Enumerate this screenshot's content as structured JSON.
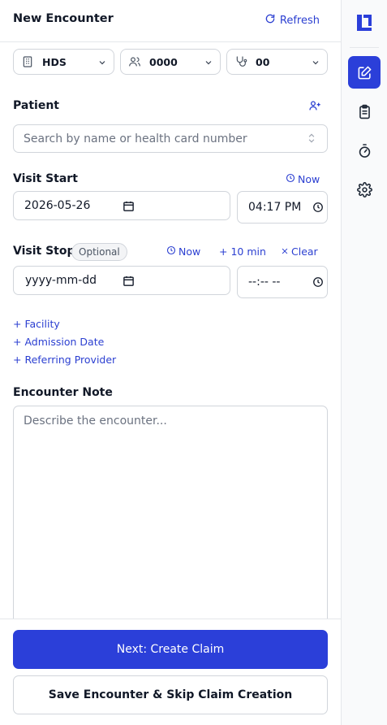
{
  "header": {
    "title": "New Encounter",
    "refresh_label": "Refresh"
  },
  "selectors": {
    "facility": {
      "value": "HDS",
      "icon": "building-icon"
    },
    "practitioner": {
      "value": "0000",
      "icon": "users-icon"
    },
    "specialty": {
      "value": "00",
      "icon": "stethoscope-icon"
    }
  },
  "patient": {
    "label": "Patient",
    "search_placeholder": "Search by name or health card number"
  },
  "visit_start": {
    "label": "Visit Start",
    "now_label": "Now",
    "date": "2026-05-26",
    "time": "04:17 PM"
  },
  "visit_stop": {
    "label": "Visit Stop",
    "optional_badge": "Optional",
    "now_label": "Now",
    "plus_label": "+ 10 min",
    "clear_label": "Clear",
    "date_placeholder": "yyyy-mm-dd",
    "time_placeholder": "--:-- --"
  },
  "extras": {
    "facility": "+ Facility",
    "admission_date": "+ Admission Date",
    "referring_provider": "+ Referring Provider"
  },
  "note": {
    "label": "Encounter Note",
    "placeholder": "Describe the encounter..."
  },
  "footer": {
    "primary": "Next: Create Claim",
    "secondary": "Save Encounter & Skip Claim Creation"
  },
  "colors": {
    "accent": "#2b3fd9",
    "link": "#2b3fd1",
    "border": "#d1d5db"
  },
  "rail": {
    "items": [
      "app-logo-icon",
      "edit-icon",
      "clipboard-icon",
      "timer-icon",
      "gear-icon"
    ],
    "active": "edit-icon"
  }
}
